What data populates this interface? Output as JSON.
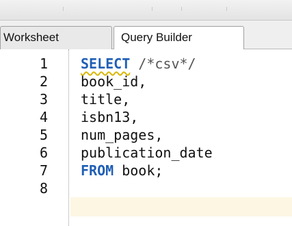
{
  "tabs": [
    {
      "label": "Worksheet"
    },
    {
      "label": "Query Builder"
    }
  ],
  "editor": {
    "line_numbers": [
      "1",
      "2",
      "3",
      "4",
      "5",
      "6",
      "7",
      "8"
    ],
    "lines": [
      {
        "keyword": "SELECT",
        "rest": " /*csv*/"
      },
      {
        "text": "book_id,"
      },
      {
        "text": "title,"
      },
      {
        "text": "isbn13,"
      },
      {
        "text": "num_pages,"
      },
      {
        "text": "publication_date"
      },
      {
        "keyword": "FROM",
        "rest": " book;"
      },
      {
        "text": ""
      }
    ],
    "colors": {
      "keyword": "#1f5fb5",
      "current_line_highlight": "#fdf6e3"
    }
  }
}
